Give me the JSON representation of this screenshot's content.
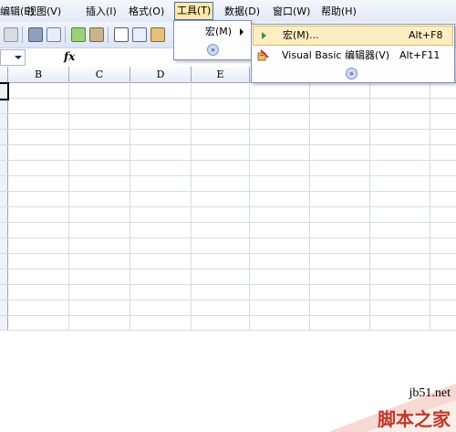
{
  "menubar": {
    "items": [
      {
        "label": "编辑(E)"
      },
      {
        "label": "视图(V)"
      },
      {
        "label": "插入(I)"
      },
      {
        "label": "格式(O)"
      },
      {
        "label": "工具(T)"
      },
      {
        "label": "数据(D)"
      },
      {
        "label": "窗口(W)"
      },
      {
        "label": "帮助(H)"
      }
    ],
    "active_index": 4
  },
  "formula_bar": {
    "fx_label": "fx"
  },
  "columns": [
    "B",
    "C",
    "D",
    "E"
  ],
  "tools_menu": {
    "items": [
      {
        "label": "宏(M)"
      }
    ]
  },
  "macro_submenu": {
    "items": [
      {
        "label": "宏(M)...",
        "shortcut": "Alt+F8",
        "icon": "play-icon"
      },
      {
        "label": "Visual Basic 编辑器(V)",
        "shortcut": "Alt+F11",
        "icon": "vb-editor-icon"
      }
    ]
  },
  "watermark": {
    "url": "jb51.net",
    "text": "脚本之家"
  },
  "colors": {
    "highlight": "#ffeec2",
    "menu_border": "#7d93c1",
    "watermark_red": "#c0392b"
  }
}
